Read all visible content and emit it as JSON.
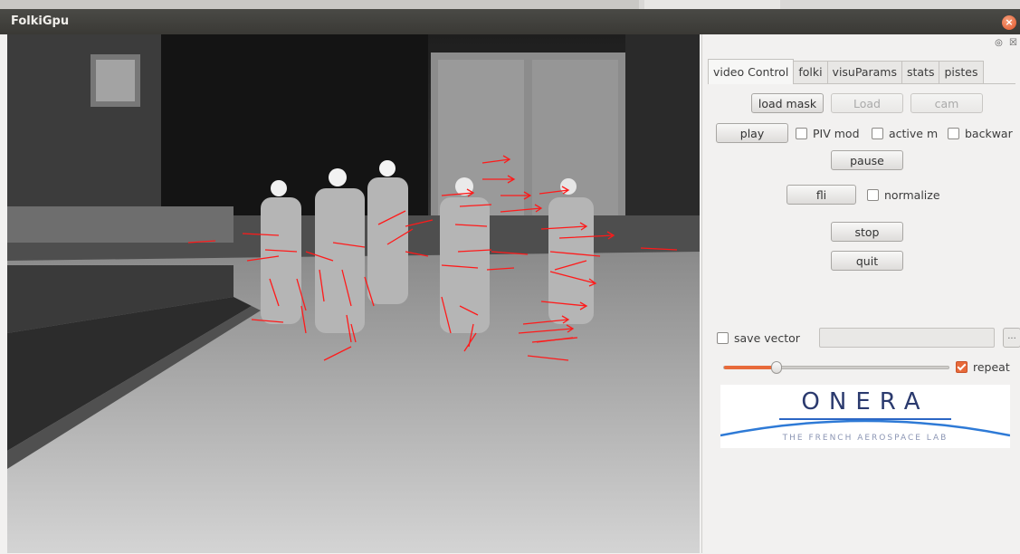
{
  "window": {
    "title": "FolkiGpu",
    "close_glyph": "×"
  },
  "dock": {
    "icons": "◎ ☒"
  },
  "tabs": [
    {
      "label": "video Control",
      "active": true
    },
    {
      "label": "folki"
    },
    {
      "label": "visuParams"
    },
    {
      "label": "stats"
    },
    {
      "label": "pistes"
    }
  ],
  "controls": {
    "load_mask": "load mask",
    "load": "Load",
    "cam": "cam",
    "play": "play",
    "piv_mode": "PIV mod",
    "active_mask": "active m",
    "backward": "backwar",
    "pause": "pause",
    "fli": "fli",
    "normalize": "normalize",
    "stop": "stop",
    "quit": "quit",
    "save_vector": "save vector",
    "save_path_value": "",
    "browse": "...",
    "repeat": "repeat",
    "repeat_checked": true,
    "slider_fraction": 0.23
  },
  "logo": {
    "name": "ONERA",
    "tagline": "THE FRENCH AEROSPACE LAB"
  },
  "colors": {
    "accent": "#e86a3a",
    "vector": "#ff1a1a",
    "titlebar": "#3c3b37"
  }
}
